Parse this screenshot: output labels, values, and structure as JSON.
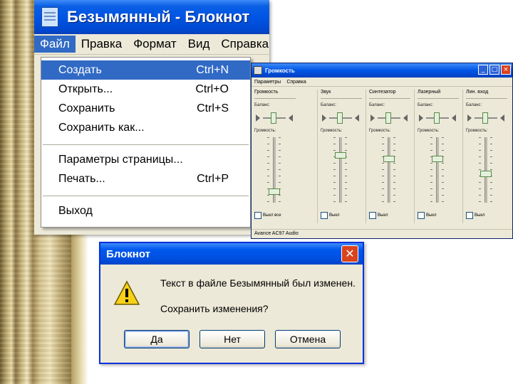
{
  "notepad": {
    "title": "Безымянный - Блокнот",
    "menubar": [
      "Файл",
      "Правка",
      "Формат",
      "Вид",
      "Справка"
    ],
    "file_menu": [
      {
        "label": "Создать",
        "shortcut": "Ctrl+N",
        "highlighted": true
      },
      {
        "label": "Открыть...",
        "shortcut": "Ctrl+O"
      },
      {
        "label": "Сохранить",
        "shortcut": "Ctrl+S"
      },
      {
        "label": "Сохранить как...",
        "shortcut": ""
      },
      {
        "label": "Параметры страницы...",
        "shortcut": ""
      },
      {
        "label": "Печать...",
        "shortcut": "Ctrl+P"
      },
      {
        "label": "Выход",
        "shortcut": ""
      }
    ]
  },
  "volume": {
    "title": "Громкость",
    "menu": [
      "Параметры",
      "Справка"
    ],
    "columns": [
      {
        "name": "Громкость",
        "balance_label": "Баланс:",
        "volume_label": "Громкость:",
        "mute_label": "Выкл все",
        "volume_level": 0.15
      },
      {
        "name": "Звук",
        "balance_label": "Баланс:",
        "volume_label": "Громкость:",
        "mute_label": "Выкл",
        "volume_level": 0.75
      },
      {
        "name": "Синтезатор",
        "balance_label": "Баланс:",
        "volume_label": "Громкость:",
        "mute_label": "Выкл",
        "volume_level": 0.7
      },
      {
        "name": "Лазерный",
        "balance_label": "Баланс:",
        "volume_label": "Громкость:",
        "mute_label": "Выкл",
        "volume_level": 0.7
      },
      {
        "name": "Лин. вход",
        "balance_label": "Баланс:",
        "volume_label": "Громкость:",
        "mute_label": "Выкл",
        "volume_level": 0.45
      }
    ],
    "status": "Avance AC97 Audio"
  },
  "dialog": {
    "title": "Блокнот",
    "message": "Текст в файле Безымянный был изменен.",
    "question": "Сохранить изменения?",
    "buttons": {
      "yes": "Да",
      "no": "Нет",
      "cancel": "Отмена"
    },
    "close_glyph": "✕"
  }
}
